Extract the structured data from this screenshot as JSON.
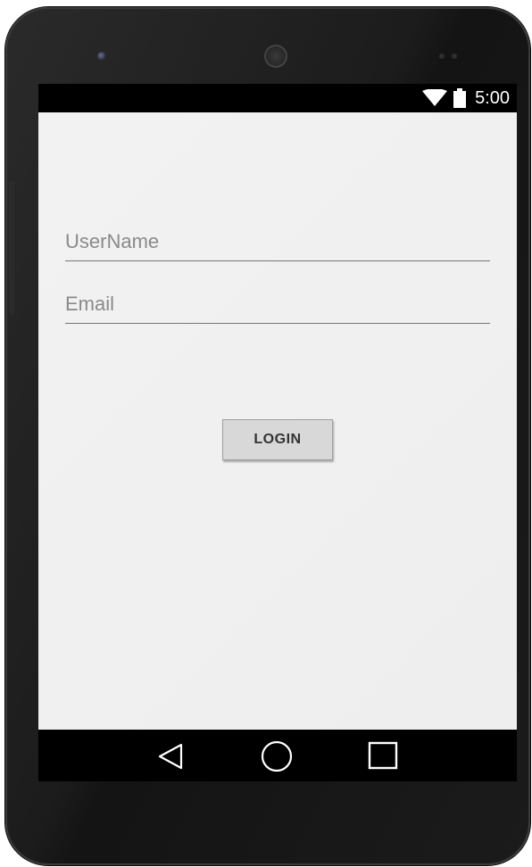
{
  "status_bar": {
    "time": "5:00",
    "icons": [
      "wifi-icon",
      "battery-icon"
    ]
  },
  "form": {
    "username_placeholder": "UserName",
    "email_placeholder": "Email",
    "login_label": "LOGIN"
  },
  "nav_bar": {
    "buttons": [
      "back-icon",
      "home-icon",
      "recents-icon"
    ]
  },
  "colors": {
    "app_background": "#eeeeee",
    "field_underline": "#757575",
    "placeholder_text": "#8a8a8a",
    "button_background": "#d8d8d8",
    "button_text": "#333333",
    "bars": "#000000"
  }
}
